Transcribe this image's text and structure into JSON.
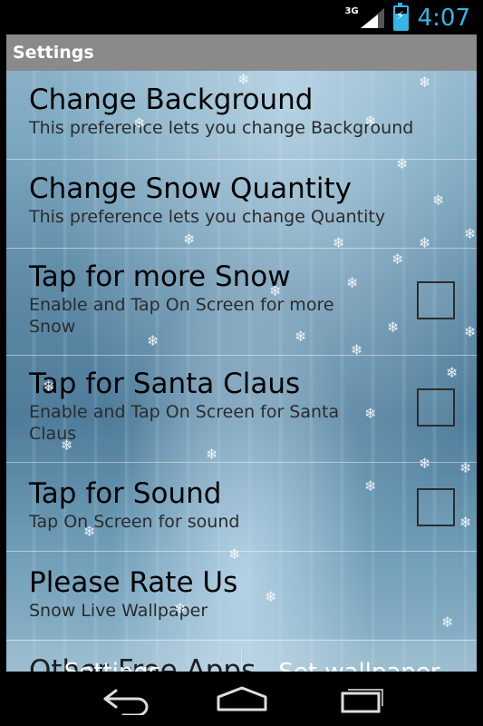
{
  "status": {
    "network": "3G",
    "time": "4:07",
    "accent": "#33b5e5"
  },
  "header": {
    "title": "Settings"
  },
  "prefs": [
    {
      "title": "Change Background",
      "summary": "This preference lets you change Background"
    },
    {
      "title": "Change Snow Quantity",
      "summary": "This preference lets you change Quantity"
    },
    {
      "title": "Tap for more Snow",
      "summary": "Enable and Tap On Screen for more Snow",
      "checked": false
    },
    {
      "title": "Tap for Santa Claus",
      "summary": "Enable and Tap On Screen for Santa Claus",
      "checked": false
    },
    {
      "title": "Tap for Sound",
      "summary": "Tap On Screen for sound",
      "checked": false
    },
    {
      "title": "Please Rate Us",
      "summary": "Snow Live Wallpaper"
    },
    {
      "title": "Other Free Apps"
    }
  ],
  "buttons": {
    "settings": "Settings...",
    "set_wallpaper": "Set wallpaper"
  },
  "nav": {
    "back": "back-icon",
    "home": "home-icon",
    "recents": "recents-icon"
  }
}
